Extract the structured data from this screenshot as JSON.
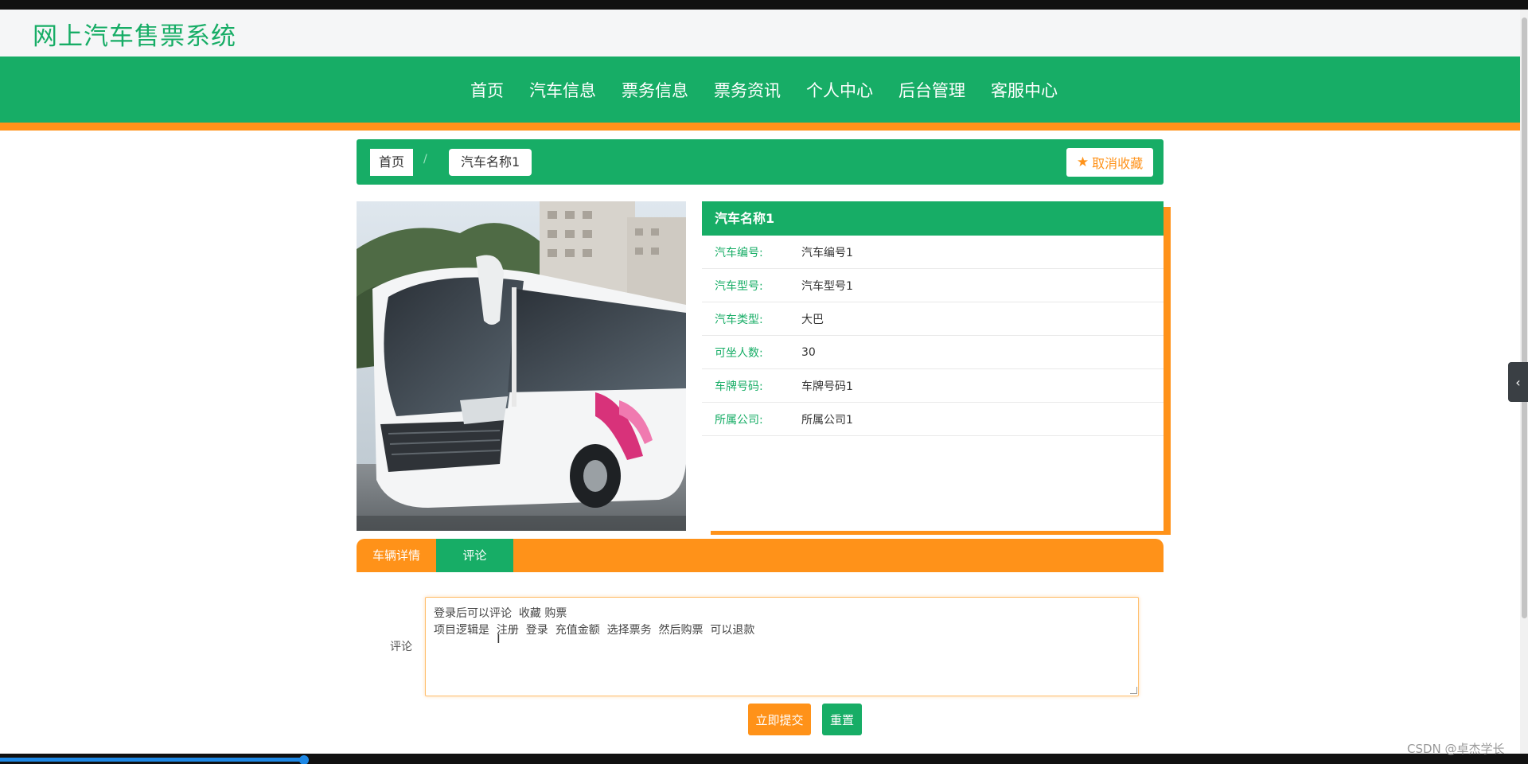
{
  "site": {
    "title": "网上汽车售票系统"
  },
  "nav": {
    "items": [
      {
        "label": "首页"
      },
      {
        "label": "汽车信息"
      },
      {
        "label": "票务信息"
      },
      {
        "label": "票务资讯"
      },
      {
        "label": "个人中心"
      },
      {
        "label": "后台管理"
      },
      {
        "label": "客服中心"
      }
    ]
  },
  "breadcrumb": {
    "home": "首页",
    "separator": "/",
    "current": "汽车名称1",
    "favorite_button": "取消收藏"
  },
  "car": {
    "name": "汽车名称1",
    "fields": [
      {
        "label": "汽车编号:",
        "value": "汽车编号1"
      },
      {
        "label": "汽车型号:",
        "value": "汽车型号1"
      },
      {
        "label": "汽车类型:",
        "value": "大巴"
      },
      {
        "label": "可坐人数:",
        "value": "30"
      },
      {
        "label": "车牌号码:",
        "value": "车牌号码1"
      },
      {
        "label": "所属公司:",
        "value": "所属公司1"
      }
    ]
  },
  "tabs": [
    {
      "label": "车辆详情",
      "active": false
    },
    {
      "label": "评论",
      "active": true
    }
  ],
  "comment": {
    "label": "评论",
    "value": "登录后可以评论  收藏 购票\n项目逻辑是  注册  登录  充值金额  选择票务  然后购票  可以退款"
  },
  "actions": {
    "submit": "立即提交",
    "reset": "重置"
  },
  "watermark": "CSDN @卓杰学长",
  "colors": {
    "primary": "#17ad66",
    "accent": "#ff9219"
  }
}
